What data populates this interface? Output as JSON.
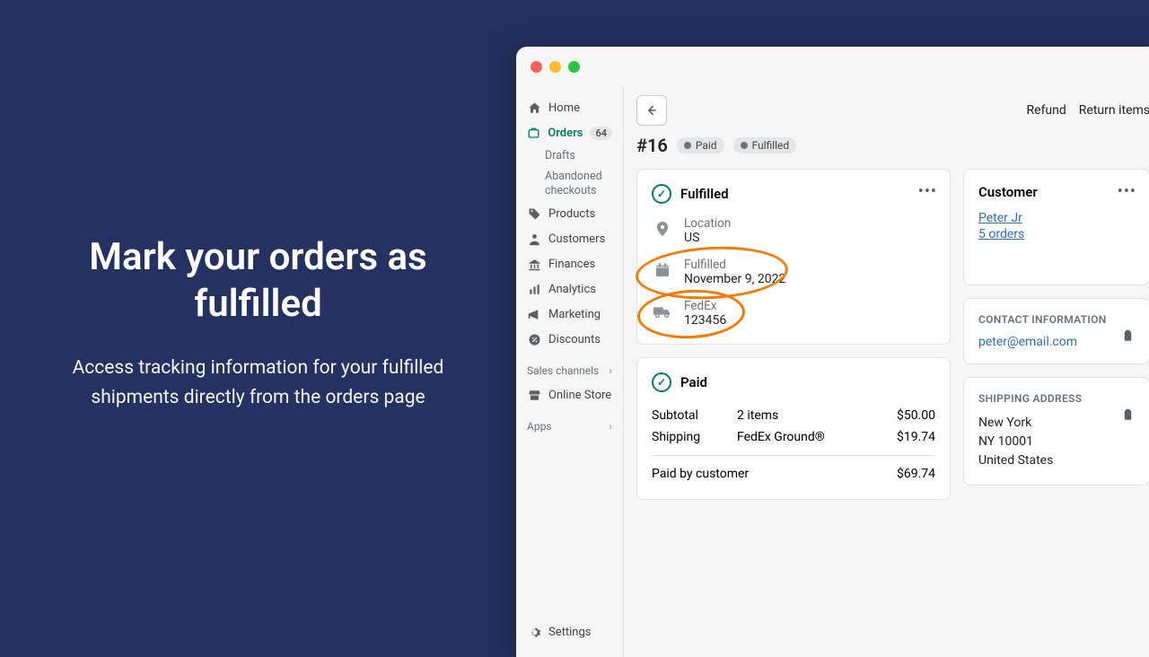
{
  "promo": {
    "title": "Mark your orders as fulfilled",
    "subtitle": "Access tracking information for your fulfilled shipments directly from the orders page"
  },
  "sidebar": {
    "home": "Home",
    "orders": "Orders",
    "orders_badge": "64",
    "drafts": "Drafts",
    "abandoned": "Abandoned checkouts",
    "products": "Products",
    "customers": "Customers",
    "finances": "Finances",
    "analytics": "Analytics",
    "marketing": "Marketing",
    "discounts": "Discounts",
    "sales_channels": "Sales channels",
    "online_store": "Online Store",
    "apps": "Apps",
    "settings": "Settings"
  },
  "actions": {
    "refund": "Refund",
    "return": "Return items"
  },
  "order": {
    "id": "#16",
    "badge_paid": "Paid",
    "badge_fulfilled": "Fulfilled"
  },
  "fulfilled_card": {
    "title": "Fulfilled",
    "location_label": "Location",
    "location_value": "US",
    "fulfilled_label": "Fulfilled",
    "fulfilled_date": "November 9, 2022",
    "carrier": "FedEx",
    "tracking": "123456"
  },
  "paid_card": {
    "title": "Paid",
    "subtotal_label": "Subtotal",
    "subtotal_qty": "2 items",
    "subtotal_val": "$50.00",
    "shipping_label": "Shipping",
    "shipping_method": "FedEx Ground®",
    "shipping_val": "$19.74",
    "total_label": "Paid by customer",
    "total_val": "$69.74"
  },
  "customer": {
    "title": "Customer",
    "name": "Peter Jr",
    "orders": "5 orders",
    "contact_title": "CONTACT INFORMATION",
    "email": "peter@email.com",
    "shipping_title": "SHIPPING ADDRESS",
    "city": "New York",
    "zip": "NY 10001",
    "country": "United States"
  }
}
